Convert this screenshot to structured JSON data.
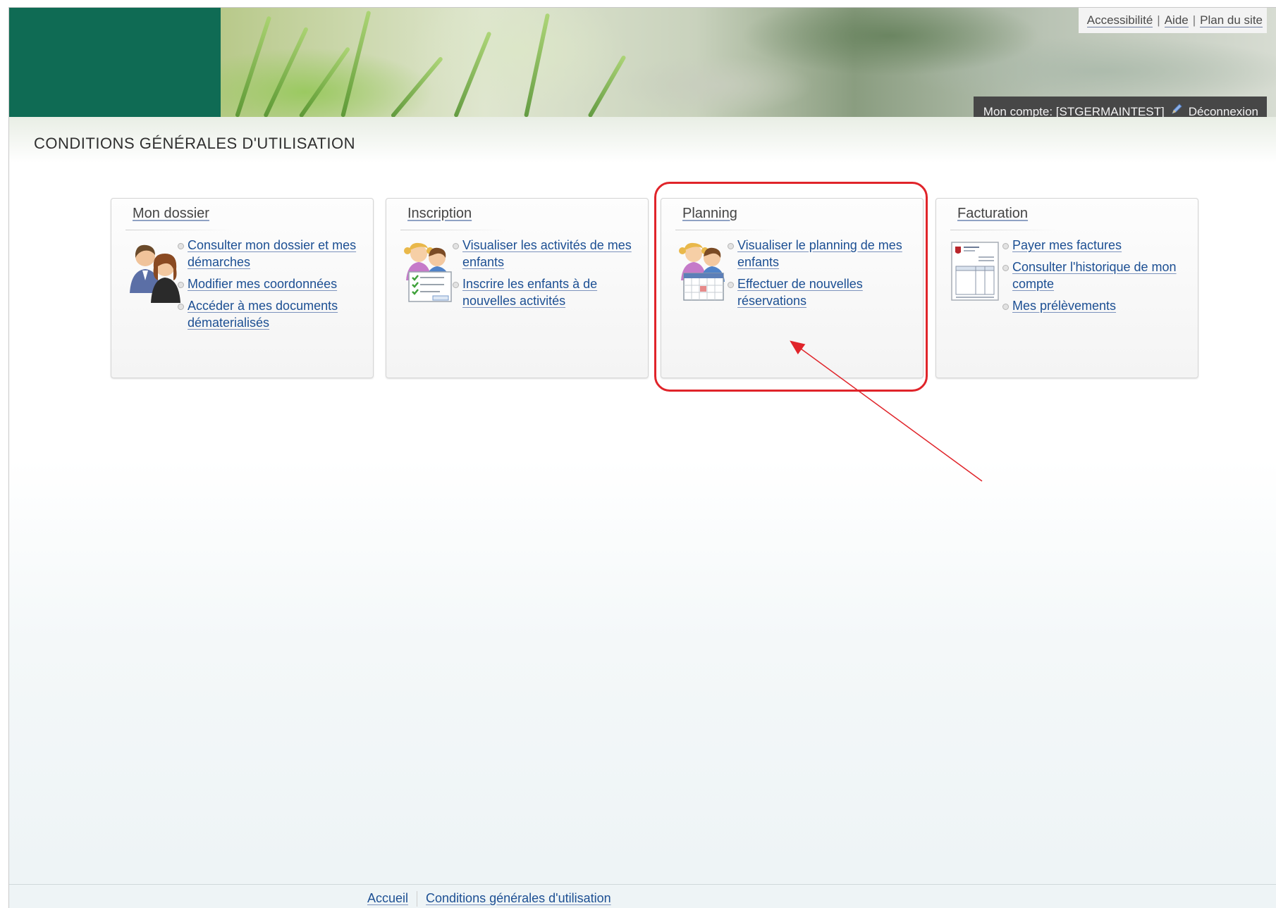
{
  "top_links": [
    {
      "label": "Accessibilité"
    },
    {
      "label": "Aide"
    },
    {
      "label": "Plan du site"
    }
  ],
  "top_links_separator": "|",
  "account": {
    "label": "Mon compte: [STGERMAINTEST]",
    "logout_label": "Déconnexion"
  },
  "page_title": "CONDITIONS GÉNÉRALES D'UTILISATION",
  "tiles": [
    {
      "title": "Mon dossier",
      "icon": "parents-icon",
      "links": [
        "Consulter mon dossier et mes démarches",
        "Modifier mes coordonnées",
        "Accéder à mes documents dématerialisés"
      ]
    },
    {
      "title": "Inscription",
      "icon": "children-checklist-icon",
      "links": [
        "Visualiser les activités de mes enfants",
        "Inscrire les enfants à de nouvelles activités"
      ]
    },
    {
      "title": "Planning",
      "icon": "children-calendar-icon",
      "links": [
        "Visualiser le planning de mes enfants",
        "Effectuer de nouvelles réservations"
      ]
    },
    {
      "title": "Facturation",
      "icon": "invoice-icon",
      "links": [
        "Payer mes factures",
        "Consulter l'historique de mon compte",
        "Mes prélèvements"
      ]
    }
  ],
  "annotation": {
    "color": "#e0242a"
  },
  "footer": {
    "links": [
      "Accueil",
      "Conditions générales d'utilisation"
    ]
  },
  "colors": {
    "brand_green": "#0f6b54",
    "link_blue": "#1c4f93",
    "account_bar": "#474747"
  }
}
